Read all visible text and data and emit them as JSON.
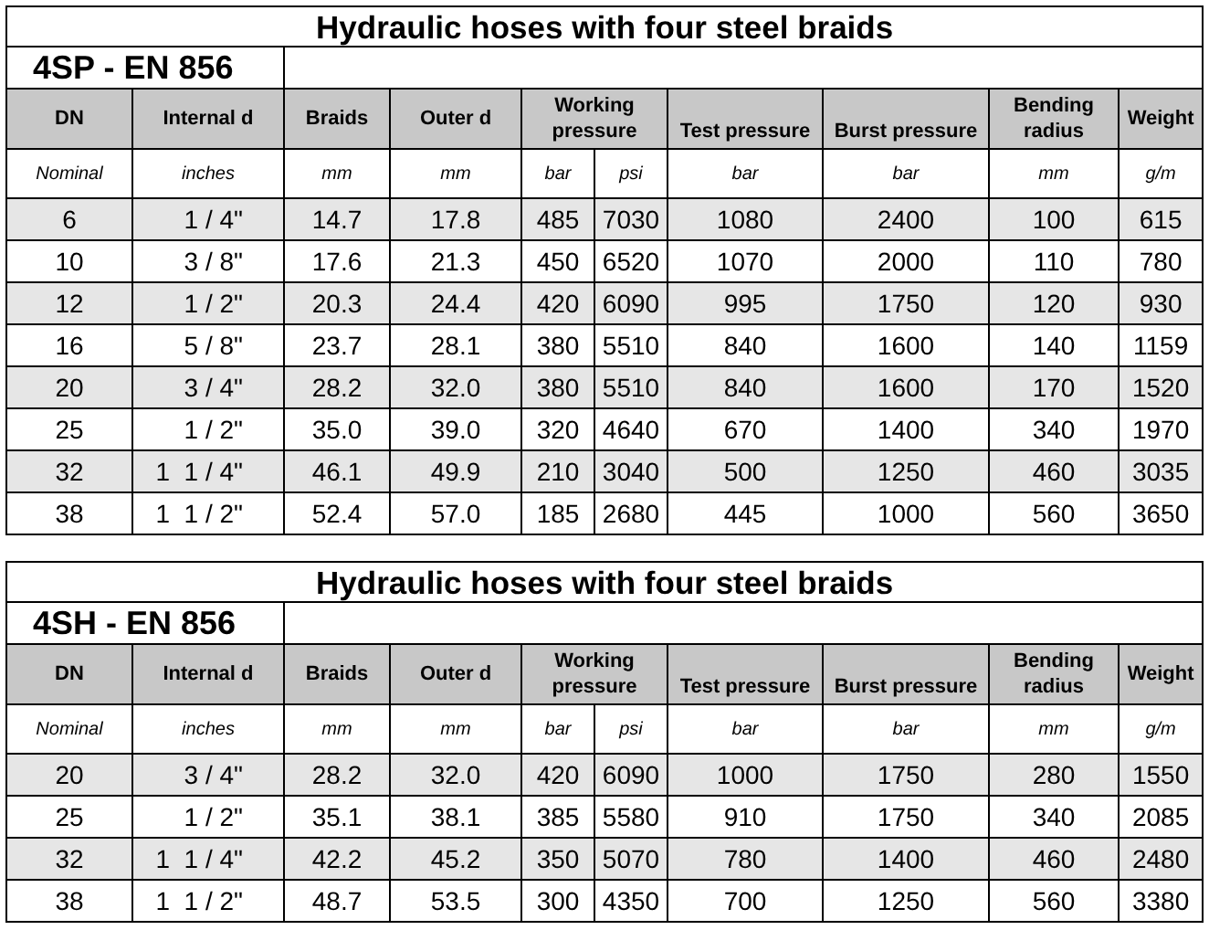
{
  "tables": [
    {
      "title": "Hydraulic hoses with four steel braids",
      "subtitle": "4SP - EN 856",
      "columns": [
        {
          "label": "DN"
        },
        {
          "label": "Internal d"
        },
        {
          "label": "Braids"
        },
        {
          "label": "Outer d"
        },
        {
          "label": "Working pressure",
          "colspan": 2
        },
        {
          "label": "Test pressure"
        },
        {
          "label": "Burst pressure"
        },
        {
          "label": "Bending radius"
        },
        {
          "label": "Weight"
        }
      ],
      "units": [
        "Nominal",
        "inches",
        "mm",
        "mm",
        "bar",
        "psi",
        "bar",
        "bar",
        "mm",
        "g/m"
      ],
      "rows": [
        [
          "6",
          "1 / 4\"",
          "14.7",
          "17.8",
          "485",
          "7030",
          "1080",
          "2400",
          "100",
          "615"
        ],
        [
          "10",
          "3 / 8\"",
          "17.6",
          "21.3",
          "450",
          "6520",
          "1070",
          "2000",
          "110",
          "780"
        ],
        [
          "12",
          "1 / 2\"",
          "20.3",
          "24.4",
          "420",
          "6090",
          "995",
          "1750",
          "120",
          "930"
        ],
        [
          "16",
          "5 / 8\"",
          "23.7",
          "28.1",
          "380",
          "5510",
          "840",
          "1600",
          "140",
          "1159"
        ],
        [
          "20",
          "3 / 4\"",
          "28.2",
          "32.0",
          "380",
          "5510",
          "840",
          "1600",
          "170",
          "1520"
        ],
        [
          "25",
          "1 / 2\"",
          "35.0",
          "39.0",
          "320",
          "4640",
          "670",
          "1400",
          "340",
          "1970"
        ],
        [
          "32",
          "1  1 / 4\"",
          "46.1",
          "49.9",
          "210",
          "3040",
          "500",
          "1250",
          "460",
          "3035"
        ],
        [
          "38",
          "1  1 / 2\"",
          "52.4",
          "57.0",
          "185",
          "2680",
          "445",
          "1000",
          "560",
          "3650"
        ]
      ]
    },
    {
      "title": "Hydraulic hoses with four steel braids",
      "subtitle": "4SH - EN 856",
      "columns": [
        {
          "label": "DN"
        },
        {
          "label": "Internal d"
        },
        {
          "label": "Braids"
        },
        {
          "label": "Outer d"
        },
        {
          "label": "Working pressure",
          "colspan": 2
        },
        {
          "label": "Test pressure"
        },
        {
          "label": "Burst pressure"
        },
        {
          "label": "Bending radius"
        },
        {
          "label": "Weight"
        }
      ],
      "units": [
        "Nominal",
        "inches",
        "mm",
        "mm",
        "bar",
        "psi",
        "bar",
        "bar",
        "mm",
        "g/m"
      ],
      "rows": [
        [
          "20",
          "3 / 4\"",
          "28.2",
          "32.0",
          "420",
          "6090",
          "1000",
          "1750",
          "280",
          "1550"
        ],
        [
          "25",
          "1 / 2\"",
          "35.1",
          "38.1",
          "385",
          "5580",
          "910",
          "1750",
          "340",
          "2085"
        ],
        [
          "32",
          "1  1 / 4\"",
          "42.2",
          "45.2",
          "350",
          "5070",
          "780",
          "1400",
          "460",
          "2480"
        ],
        [
          "38",
          "1  1 / 2\"",
          "48.7",
          "53.5",
          "300",
          "4350",
          "700",
          "1250",
          "560",
          "3380"
        ]
      ]
    }
  ]
}
